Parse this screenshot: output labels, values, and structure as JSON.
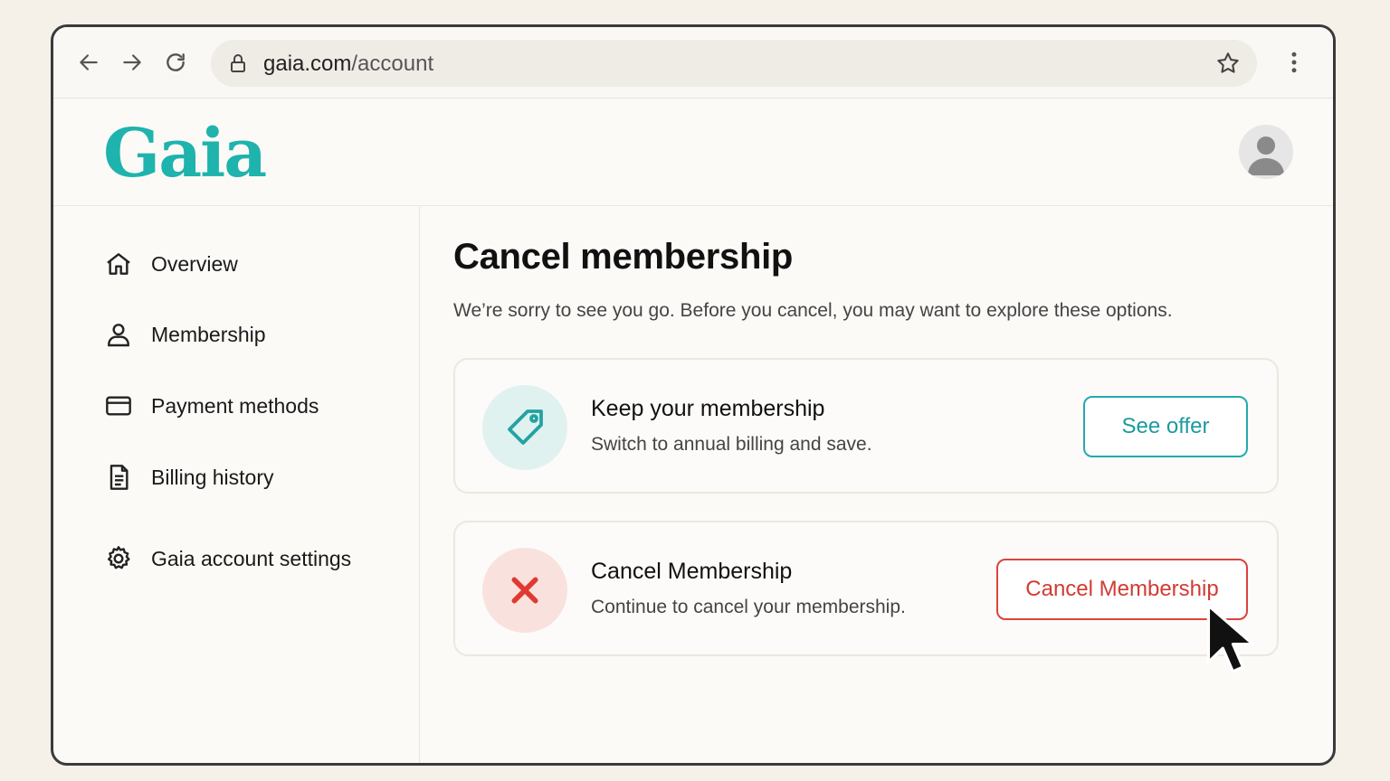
{
  "browser": {
    "url_host": "gaia.com",
    "url_path": "/account",
    "icons": [
      "back-icon",
      "forward-icon",
      "reload-icon",
      "lock-icon",
      "star-icon",
      "kebab-menu-icon"
    ]
  },
  "header": {
    "logo_text": "Gaia",
    "brand_color": "#1fb3ad"
  },
  "sidebar": {
    "items": [
      {
        "label": "Overview",
        "icon": "home-icon"
      },
      {
        "label": "Membership",
        "icon": "user-icon"
      },
      {
        "label": "Payment methods",
        "icon": "credit-card-icon"
      },
      {
        "label": "Billing history",
        "icon": "document-icon"
      },
      {
        "label": "Gaia account settings",
        "icon": "gear-icon"
      }
    ]
  },
  "main": {
    "title": "Cancel membership",
    "subtitle": "We’re sorry to see you go. Before you cancel, you may want to explore these options.",
    "cards": [
      {
        "title": "Keep your membership",
        "description": "Switch to annual billing and save.",
        "button": "See offer",
        "icon": "tag-icon",
        "accent": "#1c9aa1"
      },
      {
        "title": "Cancel Membership",
        "description": "Continue to cancel your membership.",
        "button": "Cancel Membership",
        "icon": "x-icon",
        "accent": "#d23b33"
      }
    ]
  }
}
